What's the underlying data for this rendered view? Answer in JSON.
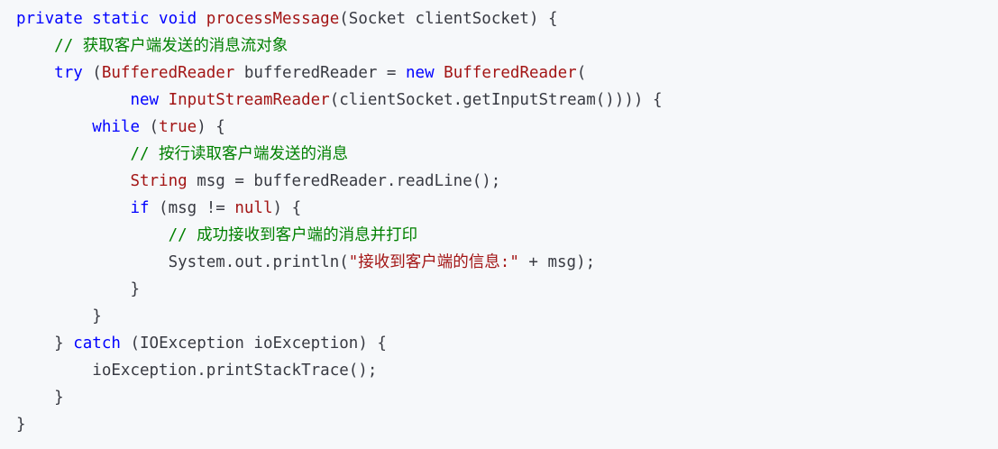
{
  "colors": {
    "background": "#f6f8fa",
    "keyword": "#0000ff",
    "identifier": "#a31515",
    "string": "#a31515",
    "comment": "#008000",
    "plain": "#383a42"
  },
  "code": {
    "l1": {
      "kw1": "private static void",
      "sp1": " ",
      "fn": "processMessage",
      "rest": "(Socket clientSocket) {"
    },
    "l2": {
      "indent": "    ",
      "cm": "// 获取客户端发送的消息流对象"
    },
    "l3": {
      "indent": "    ",
      "kw": "try",
      "p1": " (",
      "ty1": "BufferedReader",
      "p2": " bufferedReader = ",
      "kw2": "new",
      "p3": " ",
      "ty2": "BufferedReader",
      "p4": "("
    },
    "l4": {
      "indent": "            ",
      "kw": "new",
      "p1": " ",
      "ty": "InputStreamReader",
      "p2": "(clientSocket.getInputStream()))) {"
    },
    "l5": {
      "indent": "        ",
      "kw": "while",
      "p1": " (",
      "kw2": "true",
      "p2": ") {"
    },
    "l6": {
      "indent": "            ",
      "cm": "// 按行读取客户端发送的消息"
    },
    "l7": {
      "indent": "            ",
      "ty": "String",
      "p1": " msg = bufferedReader.readLine();"
    },
    "l8": {
      "indent": "            ",
      "kw": "if",
      "p1": " (msg != ",
      "kw2": "null",
      "p2": ") {"
    },
    "l9": {
      "indent": "                ",
      "cm": "// 成功接收到客户端的消息并打印"
    },
    "l10": {
      "indent": "                ",
      "p1": "System.out.println(",
      "str": "\"接收到客户端的信息:\"",
      "p2": " + msg);"
    },
    "l11": {
      "indent": "            ",
      "p1": "}"
    },
    "l12": {
      "indent": "        ",
      "p1": "}"
    },
    "l13": {
      "indent": "    ",
      "p1": "} ",
      "kw": "catch",
      "p2": " (IOException ioException) {"
    },
    "l14": {
      "indent": "        ",
      "p1": "ioException.printStackTrace();"
    },
    "l15": {
      "indent": "    ",
      "p1": "}"
    },
    "l16": {
      "indent": "",
      "p1": "}"
    }
  }
}
